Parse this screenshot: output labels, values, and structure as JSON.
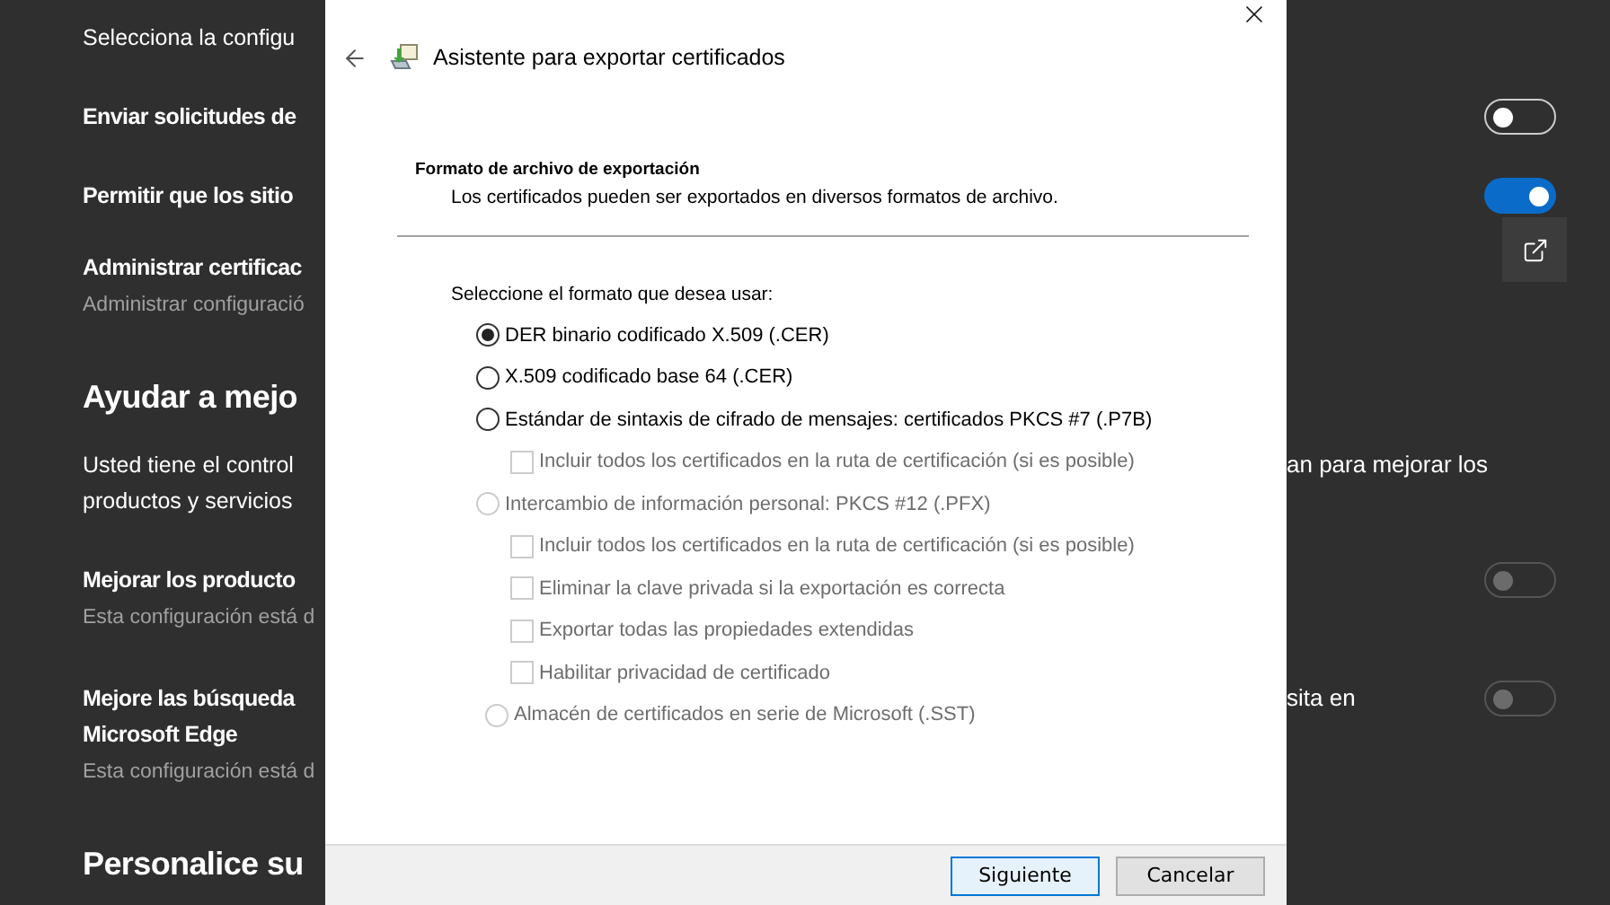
{
  "settings_page": {
    "rows": [
      {
        "kind": "note",
        "lines": [
          "Selecciona la configu"
        ]
      },
      {
        "kind": "toggle",
        "lines": [
          "Enviar solicitudes de"
        ],
        "on": false,
        "disabled": false
      },
      {
        "kind": "toggle",
        "lines": [
          "Permitir que los sitio"
        ],
        "on": true,
        "disabled": false
      },
      {
        "kind": "link",
        "lines": [
          "Administrar certificac"
        ],
        "subtitle": "Administrar configuració"
      },
      {
        "kind": "heading",
        "lines": [
          "Ayudar a mejo"
        ]
      },
      {
        "kind": "note",
        "lines": [
          "Usted tiene el control",
          "productos y servicios"
        ],
        "right": "an para mejorar los"
      },
      {
        "kind": "toggle",
        "lines": [
          "Mejorar los producto"
        ],
        "subtitle": "Esta configuración está d",
        "on": false,
        "disabled": true
      },
      {
        "kind": "toggle",
        "lines": [
          "Mejore las búsqueda",
          "Microsoft Edge"
        ],
        "right": "sita en",
        "subtitle": "Esta configuración está d",
        "on": false,
        "disabled": true
      },
      {
        "kind": "heading",
        "lines": [
          "Personalice su"
        ]
      }
    ]
  },
  "dialog": {
    "title": "Asistente para exportar certificados",
    "heading": "Formato de archivo de exportación",
    "description": "Los certificados pueden ser exportados en diversos formatos de archivo.",
    "prompt": "Seleccione el formato que desea usar:",
    "options": [
      {
        "label": "DER binario codificado X.509 (.CER)",
        "selected": true,
        "disabled": false
      },
      {
        "label": "X.509 codificado base 64 (.CER)",
        "selected": false,
        "disabled": false
      },
      {
        "label": "Estándar de sintaxis de cifrado de mensajes: certificados PKCS #7 (.P7B)",
        "selected": false,
        "disabled": false,
        "children": [
          {
            "label": "Incluir todos los certificados en la ruta de certificación (si es posible)",
            "checked": false,
            "disabled": true
          }
        ]
      },
      {
        "label": "Intercambio de información personal: PKCS #12 (.PFX)",
        "selected": false,
        "disabled": true,
        "children": [
          {
            "label": "Incluir todos los certificados en la ruta de certificación (si es posible)",
            "checked": false,
            "disabled": true
          },
          {
            "label": "Eliminar la clave privada si la exportación es correcta",
            "checked": false,
            "disabled": true
          },
          {
            "label": "Exportar todas las propiedades extendidas",
            "checked": false,
            "disabled": true
          },
          {
            "label": "Habilitar privacidad de certificado",
            "checked": false,
            "disabled": true
          }
        ]
      },
      {
        "label": "Almacén de certificados en serie de Microsoft (.SST)",
        "selected": false,
        "disabled": true
      }
    ],
    "buttons": [
      {
        "label": "Siguiente",
        "default": true
      },
      {
        "label": "Cancelar",
        "default": false
      }
    ]
  }
}
